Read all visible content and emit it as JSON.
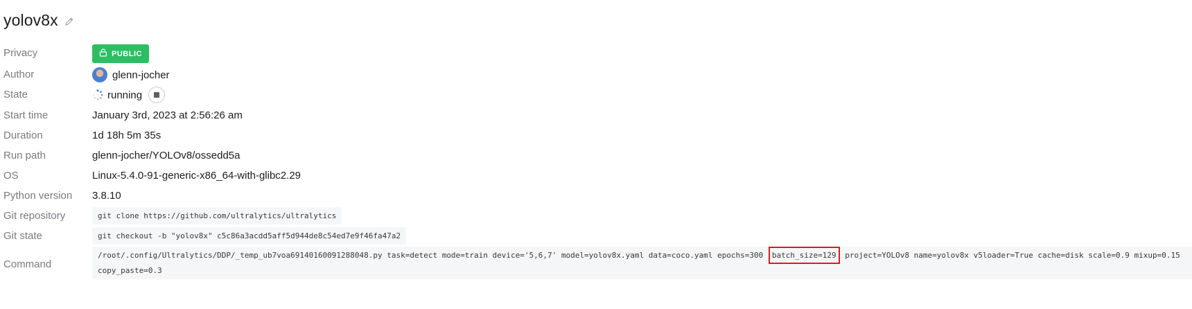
{
  "run": {
    "title": "yolov8x"
  },
  "fields": {
    "privacy": {
      "label": "Privacy",
      "value": "PUBLIC"
    },
    "author": {
      "label": "Author",
      "value": "glenn-jocher"
    },
    "state": {
      "label": "State",
      "value": "running"
    },
    "start_time": {
      "label": "Start time",
      "value": "January 3rd, 2023 at 2:56:26 am"
    },
    "duration": {
      "label": "Duration",
      "value": "1d 18h 5m 35s"
    },
    "run_path": {
      "label": "Run path",
      "value": "glenn-jocher/YOLOv8/ossedd5a"
    },
    "os": {
      "label": "OS",
      "value": "Linux-5.4.0-91-generic-x86_64-with-glibc2.29"
    },
    "python_version": {
      "label": "Python version",
      "value": "3.8.10"
    },
    "git_repository": {
      "label": "Git repository",
      "value": "git clone https://github.com/ultralytics/ultralytics"
    },
    "git_state": {
      "label": "Git state",
      "value": "git checkout -b \"yolov8x\" c5c86a3acdd5aff5d944de8c54ed7e9f46fa47a2"
    },
    "command": {
      "label": "Command",
      "part1": "/root/.config/Ultralytics/DDP/_temp_ub7voa69140160091288048.py task=detect mode=train device='5,6,7' model=yolov8x.yaml data=coco.yaml epochs=300",
      "highlighted": "batch_size=129",
      "part2": "project=YOLOv8 name=yolov8x v5loader=True cache=disk scale=0.9 mixup=0.15",
      "line2": "copy_paste=0.3"
    }
  },
  "icons": {
    "edit": "pencil-icon",
    "privacy": "unlock-icon",
    "state": "spinner-icon",
    "stop": "stop-icon"
  },
  "colors": {
    "public_badge": "#2dbe63",
    "highlight_box": "#e0191c",
    "label_text": "#797b80"
  }
}
